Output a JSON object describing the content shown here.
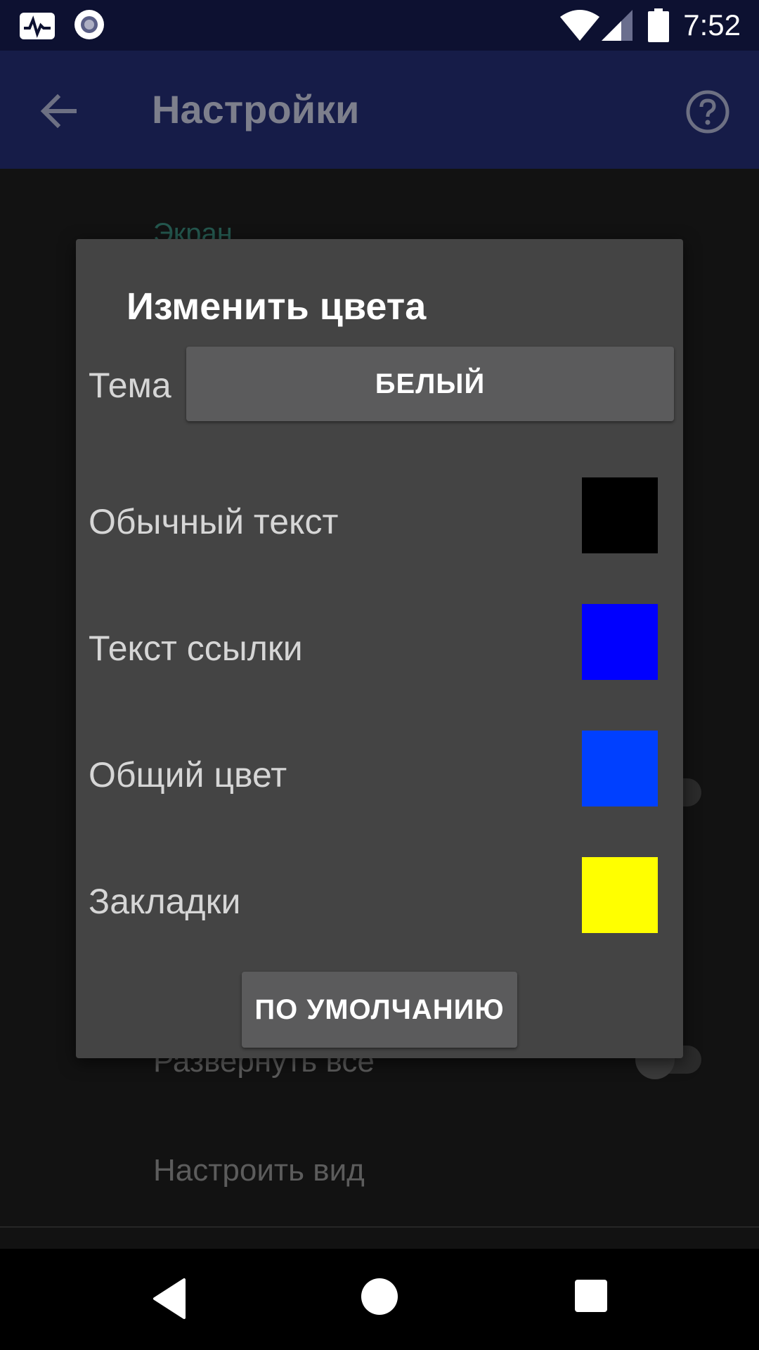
{
  "status_bar": {
    "time": "7:52",
    "icons": [
      "pulse-app-icon",
      "record-icon",
      "wifi-icon",
      "signal-icon",
      "battery-icon"
    ]
  },
  "toolbar": {
    "title": "Настройки",
    "back_icon": "arrow-left-icon",
    "help_icon": "help-circle-icon"
  },
  "background_settings": {
    "section_header": "Экран",
    "expand_all": "Развернуть все",
    "customize_view": "Настроить вид"
  },
  "dialog": {
    "title": "Изменить цвета",
    "theme": {
      "label": "Тема",
      "value": "БЕЛЫЙ"
    },
    "rows": [
      {
        "label": "Обычный текст",
        "color": "#000000"
      },
      {
        "label": "Текст ссылки",
        "color": "#0000ff"
      },
      {
        "label": "Общий цвет",
        "color": "#0040ff"
      },
      {
        "label": "Закладки",
        "color": "#ffff00"
      }
    ],
    "defaults_label": "ПО УМОЛЧАНИЮ"
  },
  "nav_bar": {
    "icons": [
      "back-triangle-icon",
      "home-circle-icon",
      "recents-square-icon"
    ]
  }
}
